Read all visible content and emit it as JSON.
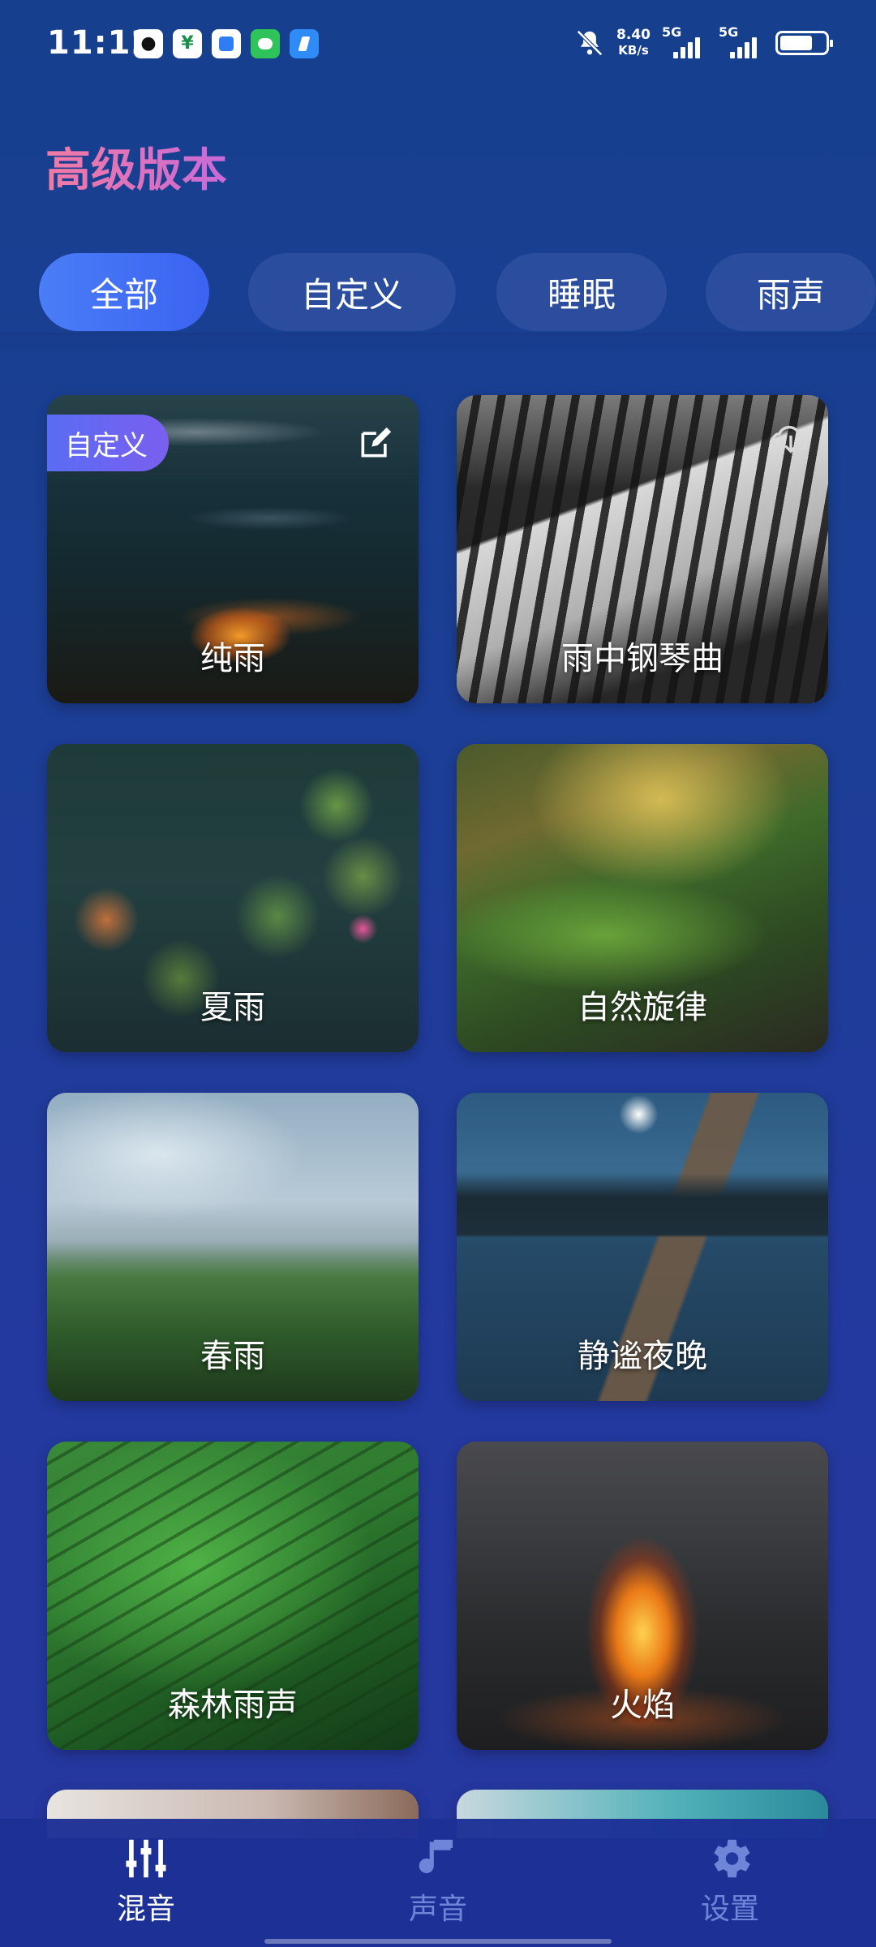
{
  "status_bar": {
    "time": "11:12",
    "speed_value": "8.40",
    "speed_unit": "KB/s",
    "net1": "5G",
    "net2": "5G"
  },
  "page": {
    "title": "高级版本"
  },
  "tabs": [
    {
      "label": "全部",
      "active": true
    },
    {
      "label": "自定义",
      "active": false
    },
    {
      "label": "睡眠",
      "active": false
    },
    {
      "label": "雨声",
      "active": false
    }
  ],
  "cards": [
    {
      "title": "纯雨",
      "badge": "自定义",
      "icon": "edit-icon"
    },
    {
      "title": "雨中钢琴曲",
      "icon": "cloud-download-icon"
    },
    {
      "title": "夏雨"
    },
    {
      "title": "自然旋律"
    },
    {
      "title": "春雨"
    },
    {
      "title": "静谧夜晚"
    },
    {
      "title": "森林雨声"
    },
    {
      "title": "火焰"
    }
  ],
  "bottom_nav": [
    {
      "label": "混音",
      "icon": "mixer-icon",
      "active": true
    },
    {
      "label": "声音",
      "icon": "music-note-icon",
      "active": false
    },
    {
      "label": "设置",
      "icon": "gear-icon",
      "active": false
    }
  ]
}
